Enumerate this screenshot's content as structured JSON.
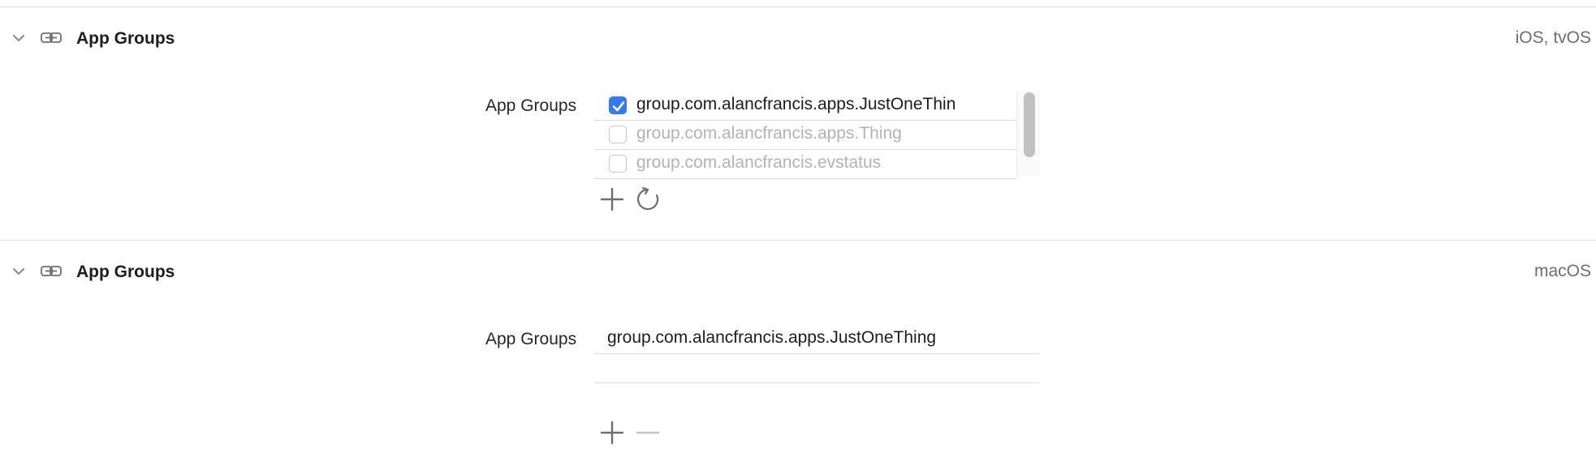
{
  "sections": [
    {
      "title": "App Groups",
      "platform": "iOS, tvOS",
      "field_label": "App Groups",
      "groups": [
        {
          "name": "group.com.alancfrancis.apps.JustOneThin",
          "checked": true
        },
        {
          "name": "group.com.alancfrancis.apps.Thing",
          "checked": false
        },
        {
          "name": "group.com.alancfrancis.evstatus",
          "checked": false
        }
      ]
    },
    {
      "title": "App Groups",
      "platform": "macOS",
      "field_label": "App Groups",
      "groups": [
        {
          "name": "group.com.alancfrancis.apps.JustOneThing"
        },
        {
          "name": ""
        }
      ]
    }
  ],
  "icons": {
    "collapse": "chevron-down-icon",
    "capability": "link-badge-icon",
    "add": "plus-icon",
    "refresh": "refresh-icon",
    "remove": "minus-icon"
  },
  "colors": {
    "accent": "#3478f6",
    "text": "#1d1d1d",
    "muted": "#6e6e6e",
    "disabled_text": "#b3b3b3",
    "divider": "#e0e0e0"
  }
}
